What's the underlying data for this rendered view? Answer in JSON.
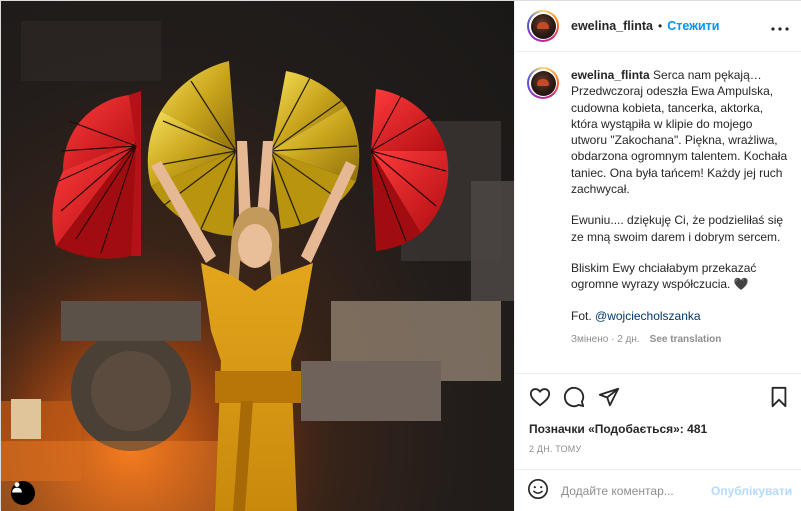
{
  "post": {
    "username": "ewelina_flinta",
    "separator": "•",
    "follow_label": "Стежити",
    "caption": {
      "username": "ewelina_flinta",
      "paragraphs": [
        "Serca nam pękają… Przedwczoraj odeszła Ewa Ampulska, cudowna kobieta, tancerka, aktorka, która wystąpiła w klipie do mojego utworu \"Zakochana\". Piękna, wrażliwa, obdarzona ogromnym talentem. Kochała taniec. Ona była tańcem! Każdy jej ruch zachwycał.",
        "Ewuniu.... dziękuję Ci, że podzieliłaś się ze mną swoim darem i dobrym sercem.",
        "Bliskim Ewy chciałabym przekazać ogromne wyrazy współczucia. 🖤"
      ],
      "credit_prefix": "Fot. ",
      "credit_handle": "@wojciecholszanka",
      "edited": "Змінено · 2 дн.",
      "see_translation": "See translation"
    },
    "likes_label": "Позначки «Подобається»:",
    "likes_count": "481",
    "timestamp": "2 ДН. ТОМУ",
    "comment_placeholder": "Додайте коментар...",
    "publish_label": "Опублікувати"
  },
  "icons": {
    "more": "more-icon",
    "like": "heart-icon",
    "comment": "comment-icon",
    "share": "share-icon",
    "save": "bookmark-icon",
    "emoji": "emoji-icon",
    "tags": "user-tag-icon"
  },
  "colors": {
    "follow": "#0095f6",
    "publish_disabled": "#b3dbff",
    "muted": "#8e8e8e",
    "link": "#00376b"
  }
}
